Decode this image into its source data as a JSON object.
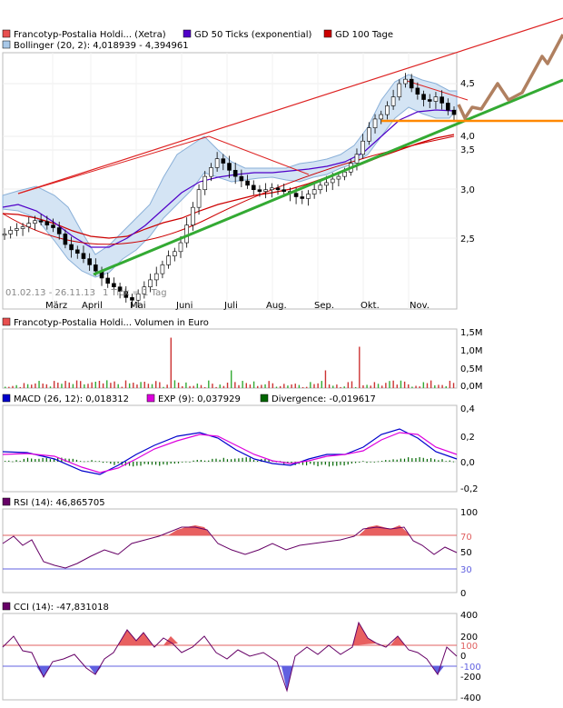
{
  "chart_data": [
    {
      "type": "candlestick",
      "panel": "price",
      "legend": [
        {
          "label": "Francotyp-Postalia Holdi... (Xetra)",
          "color": "#e85050"
        },
        {
          "label": "GD 50 Ticks (exponential)",
          "color": "#5000c8"
        },
        {
          "label": "GD 100 Tage",
          "color": "#cc0000"
        },
        {
          "label": "Bollinger (20, 2): 4,018939 - 4,394961",
          "color": "#a8c8e8"
        }
      ],
      "y_ticks": [
        "4,5",
        "4,0",
        "3,5",
        "3,0",
        "2,5"
      ],
      "x_ticks": [
        "März",
        "April",
        "Mai",
        "Juni",
        "Juli",
        "Aug.",
        "Sep.",
        "Okt.",
        "Nov."
      ],
      "range_text": "01.02.13 - 26.11.13",
      "tick_text": "1 Tick = 1 Tag",
      "ylim": [
        1.95,
        4.85
      ],
      "close_series": [
        2.8,
        2.84,
        2.86,
        2.88,
        2.92,
        2.95,
        2.94,
        2.9,
        2.87,
        2.8,
        2.68,
        2.62,
        2.58,
        2.52,
        2.45,
        2.38,
        2.3,
        2.24,
        2.2,
        2.15,
        2.08,
        2.05,
        2.12,
        2.2,
        2.28,
        2.35,
        2.45,
        2.55,
        2.6,
        2.7,
        2.9,
        3.1,
        3.3,
        3.45,
        3.55,
        3.65,
        3.6,
        3.52,
        3.45,
        3.4,
        3.35,
        3.3,
        3.28,
        3.3,
        3.32,
        3.3,
        3.28,
        3.26,
        3.22,
        3.2,
        3.25,
        3.3,
        3.35,
        3.38,
        3.42,
        3.45,
        3.5,
        3.6,
        3.7,
        3.85,
        4.0,
        4.1,
        4.15,
        4.25,
        4.35,
        4.5,
        4.55,
        4.45,
        4.38,
        4.32,
        4.3,
        4.35,
        4.28,
        4.2,
        4.15
      ],
      "trendlines_note": "Support and resistance trendlines with projected path"
    },
    {
      "type": "bar",
      "panel": "volume",
      "legend": [
        {
          "label": "Francotyp-Postalia Holdi... Volumen in Euro",
          "color": "#e85050"
        }
      ],
      "y_ticks": [
        "1,5M",
        "1,0M",
        "0,5M",
        "0,0M"
      ],
      "ylim": [
        0,
        1.5
      ]
    },
    {
      "type": "line",
      "panel": "macd",
      "legend": [
        {
          "label": "MACD (26, 12): 0,018312",
          "color": "#0000cc"
        },
        {
          "label": "EXP (9): 0,037929",
          "color": "#dd00dd"
        },
        {
          "label": "Divergence: -0,019617",
          "color": "#006600"
        }
      ],
      "y_ticks": [
        "0,4",
        "0,2",
        "0,0",
        "-0,2"
      ],
      "ylim": [
        -0.2,
        0.4
      ]
    },
    {
      "type": "line",
      "panel": "rsi",
      "legend": [
        {
          "label": "RSI (14): 46,865705",
          "color": "#660066"
        }
      ],
      "y_ticks": [
        "100",
        "70",
        "50",
        "30",
        "0"
      ],
      "ylim": [
        0,
        100
      ],
      "levels": [
        70,
        30
      ]
    },
    {
      "type": "line",
      "panel": "cci",
      "legend": [
        {
          "label": "CCI (14): -47,831018",
          "color": "#660066"
        }
      ],
      "y_ticks": [
        "400",
        "200",
        "100",
        "0",
        "-100",
        "-200",
        "-400"
      ],
      "ylim": [
        -400,
        400
      ],
      "levels": [
        100,
        -100
      ]
    }
  ]
}
